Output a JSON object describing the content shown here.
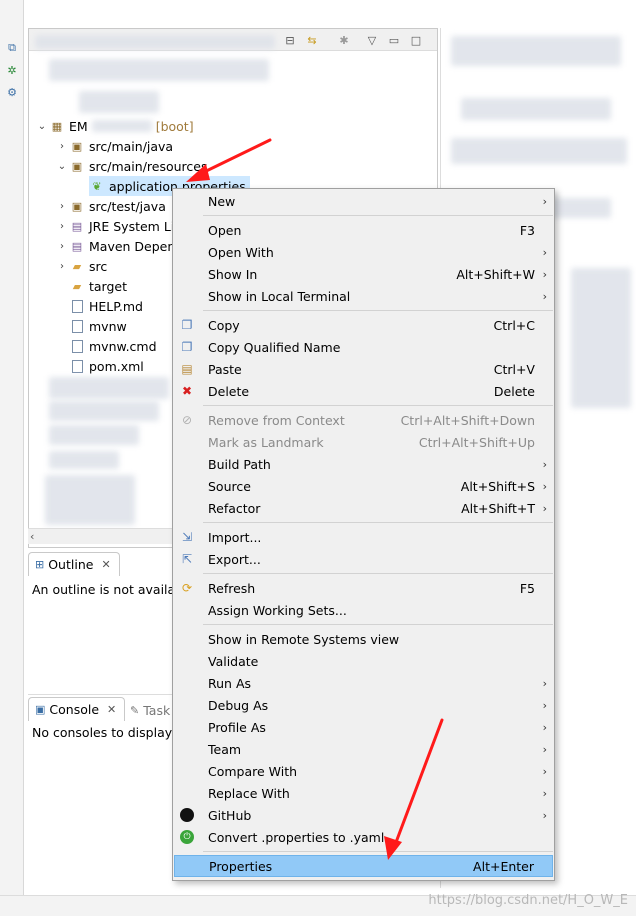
{
  "explorer": {
    "project_name_prefix": "EM",
    "project_suffix": "[boot]",
    "tree": [
      {
        "label": "src/main/java",
        "chevron": "›"
      },
      {
        "label": "src/main/resources",
        "chevron": "⌄"
      },
      {
        "label": "application.properties"
      },
      {
        "label": "src/test/java",
        "chevron": "›"
      },
      {
        "label": "JRE System Li",
        "chevron": "›"
      },
      {
        "label": "Maven Depen",
        "chevron": "›"
      },
      {
        "label": "src",
        "chevron": "›"
      },
      {
        "label": "target"
      },
      {
        "label": "HELP.md"
      },
      {
        "label": "mvnw"
      },
      {
        "label": "mvnw.cmd"
      },
      {
        "label": "pom.xml"
      }
    ]
  },
  "outline": {
    "tab_label": "Outline",
    "message": "An outline is not availab"
  },
  "console": {
    "tab_label": "Console",
    "tab2_label": "Task",
    "message": "No consoles to display a"
  },
  "context_menu": {
    "items": [
      {
        "label": "New",
        "accel": "",
        "sub": true
      },
      {
        "label": "Open",
        "accel": "F3"
      },
      {
        "label": "Open With",
        "accel": "",
        "sub": true
      },
      {
        "label": "Show In",
        "accel": "Alt+Shift+W",
        "sub": true
      },
      {
        "label": "Show in Local Terminal",
        "accel": "",
        "sub": true
      },
      {
        "label": "Copy",
        "accel": "Ctrl+C",
        "icon": "copy-icon"
      },
      {
        "label": "Copy Qualified Name",
        "accel": "",
        "icon": "copy-qualified-icon"
      },
      {
        "label": "Paste",
        "accel": "Ctrl+V",
        "icon": "paste-icon"
      },
      {
        "label": "Delete",
        "accel": "Delete",
        "icon": "delete-icon"
      },
      {
        "label": "Remove from Context",
        "accel": "Ctrl+Alt+Shift+Down",
        "disabled": true
      },
      {
        "label": "Mark as Landmark",
        "accel": "Ctrl+Alt+Shift+Up",
        "disabled": true
      },
      {
        "label": "Build Path",
        "accel": "",
        "sub": true
      },
      {
        "label": "Source",
        "accel": "Alt+Shift+S",
        "sub": true
      },
      {
        "label": "Refactor",
        "accel": "Alt+Shift+T",
        "sub": true
      },
      {
        "label": "Import...",
        "accel": "",
        "icon": "import-icon"
      },
      {
        "label": "Export...",
        "accel": "",
        "icon": "export-icon"
      },
      {
        "label": "Refresh",
        "accel": "F5",
        "icon": "refresh-icon"
      },
      {
        "label": "Assign Working Sets...",
        "accel": ""
      },
      {
        "label": "Show in Remote Systems view",
        "accel": ""
      },
      {
        "label": "Validate",
        "accel": ""
      },
      {
        "label": "Run As",
        "accel": "",
        "sub": true
      },
      {
        "label": "Debug As",
        "accel": "",
        "sub": true
      },
      {
        "label": "Profile As",
        "accel": "",
        "sub": true
      },
      {
        "label": "Team",
        "accel": "",
        "sub": true
      },
      {
        "label": "Compare With",
        "accel": "",
        "sub": true
      },
      {
        "label": "Replace With",
        "accel": "",
        "sub": true
      },
      {
        "label": "GitHub",
        "accel": "",
        "sub": true,
        "icon": "github-icon"
      },
      {
        "label": "Convert .properties to .yaml",
        "accel": "",
        "icon": "spring-icon"
      },
      {
        "label": "Properties",
        "accel": "Alt+Enter",
        "highlight": true
      }
    ]
  },
  "watermark": "https://blog.csdn.net/H_O_W_E",
  "colors": {
    "highlight": "#91c9f7",
    "annotation_arrow": "#ff1a1a",
    "menu_bg": "#f0f0f0"
  }
}
